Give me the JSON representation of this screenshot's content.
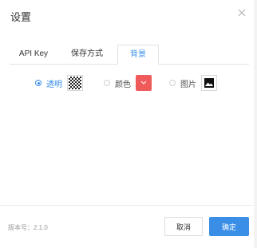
{
  "dialog": {
    "title": "设置",
    "close_icon": "close-icon"
  },
  "tabs": [
    {
      "label": "API Key",
      "active": false
    },
    {
      "label": "保存方式",
      "active": false
    },
    {
      "label": "背景",
      "active": true
    }
  ],
  "background_options": [
    {
      "label": "透明",
      "checked": true,
      "preview": "checkerboard-icon"
    },
    {
      "label": "颜色",
      "checked": false,
      "preview": "color-swatch",
      "color": "#ef5b5b"
    },
    {
      "label": "图片",
      "checked": false,
      "preview": "image-icon"
    }
  ],
  "footer": {
    "version": "版本号：2.1.0",
    "cancel_label": "取消",
    "ok_label": "确定"
  },
  "colors": {
    "accent": "#3a8ee6",
    "swatch": "#ef5b5b"
  }
}
